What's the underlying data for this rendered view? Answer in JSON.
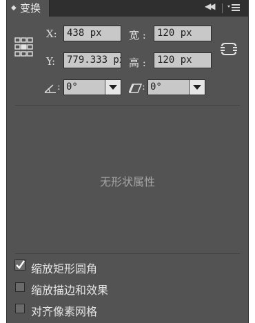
{
  "panel": {
    "tab_title": "变换",
    "menu_icon": "panel-menu-icon",
    "collapse_icon": "collapse-double-arrow-icon"
  },
  "position": {
    "x_label": "X:",
    "x_value": "438 px",
    "y_label": "Y:",
    "y_value": "779.333 px"
  },
  "size": {
    "width_label": "宽 :",
    "width_value": "120 px",
    "height_label": "高 :",
    "height_value": "120 px"
  },
  "rotate": {
    "label": "∠:",
    "value": "0°"
  },
  "shear": {
    "label": "▱:",
    "value": "0°"
  },
  "shape_properties_message": "无形状属性",
  "options": [
    {
      "label": "缩放矩形圆角",
      "checked": true
    },
    {
      "label": "缩放描边和效果",
      "checked": false
    },
    {
      "label": "对齐像素网格",
      "checked": false
    }
  ],
  "colors": {
    "panel_bg": "#535353",
    "titlebar_bg": "#2f2f2f",
    "field_bg": "#c8c8c8"
  }
}
